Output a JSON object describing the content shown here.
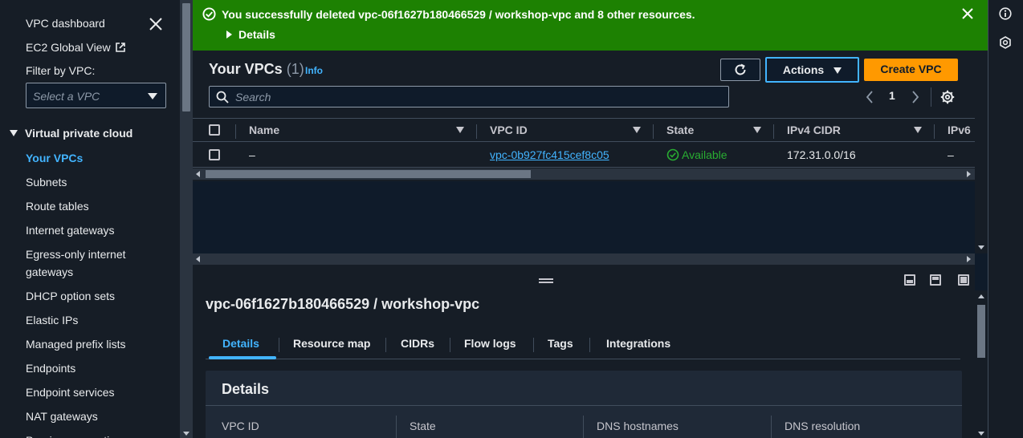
{
  "sidebar": {
    "dashboard_label": "VPC dashboard",
    "global_view_label": "EC2 Global View",
    "filter_label": "Filter by VPC:",
    "filter_placeholder": "Select a VPC",
    "section_title": "Virtual private cloud",
    "items": [
      {
        "label": "Your VPCs",
        "active": true
      },
      {
        "label": "Subnets"
      },
      {
        "label": "Route tables"
      },
      {
        "label": "Internet gateways"
      },
      {
        "label": "Egress-only internet gateways"
      },
      {
        "label": "DHCP option sets"
      },
      {
        "label": "Elastic IPs"
      },
      {
        "label": "Managed prefix lists"
      },
      {
        "label": "Endpoints"
      },
      {
        "label": "Endpoint services"
      },
      {
        "label": "NAT gateways"
      },
      {
        "label": "Peering connections"
      }
    ]
  },
  "flash": {
    "message": "You successfully deleted vpc-06f1627b180466529 / workshop-vpc and 8 other resources.",
    "details_label": "Details",
    "color": "#1d8102"
  },
  "vpc_table": {
    "title": "Your VPCs",
    "count": "(1)",
    "info_label": "Info",
    "actions_label": "Actions",
    "create_label": "Create VPC",
    "search_placeholder": "Search",
    "current_page": "1",
    "columns": [
      "Name",
      "VPC ID",
      "State",
      "IPv4 CIDR",
      "IPv6"
    ],
    "rows": [
      {
        "name": "–",
        "vpc_id": "vpc-0b927fc415cef8c05",
        "state": "Available",
        "ipv4_cidr": "172.31.0.0/16",
        "ipv6": "–"
      }
    ]
  },
  "split_panel": {
    "title": "vpc-06f1627b180466529 / workshop-vpc",
    "tabs": [
      "Details",
      "Resource map",
      "CIDRs",
      "Flow logs",
      "Tags",
      "Integrations"
    ],
    "active_tab": "Details",
    "card_title": "Details",
    "fields": [
      "VPC ID",
      "State",
      "DNS hostnames",
      "DNS resolution"
    ]
  },
  "colors": {
    "accent": "#42b4ff",
    "primary_button": "#ff9900",
    "success": "#29ad32"
  }
}
